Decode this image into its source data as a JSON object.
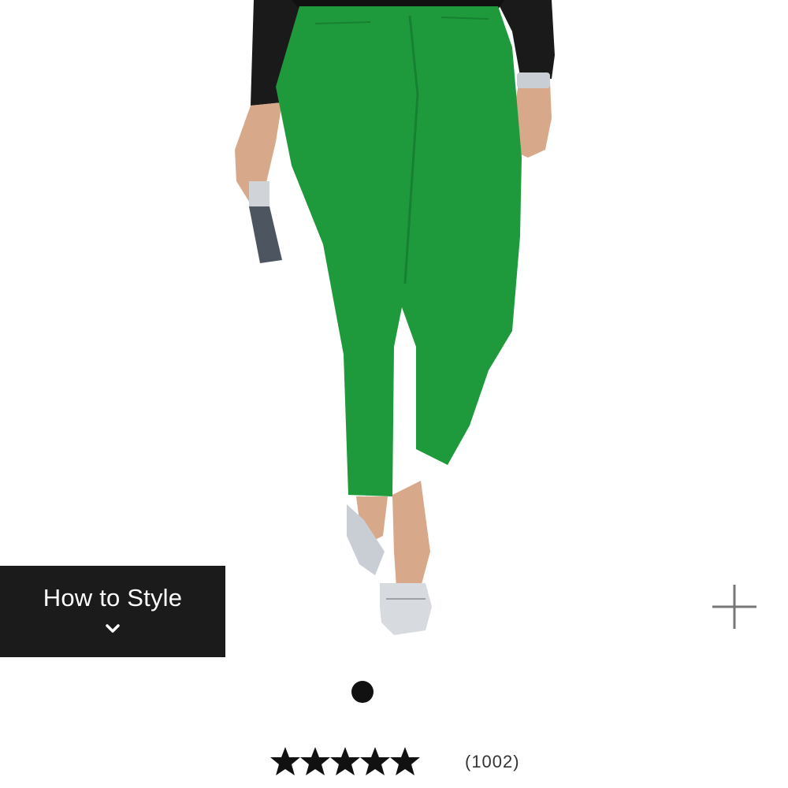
{
  "product": {
    "image_description_icon": "product-photo-green-pants",
    "colors": {
      "pants": "#1e9a3c",
      "top": "#1a1a1a",
      "skin": "#d8a88a",
      "shoes": "#c9ced4"
    }
  },
  "style_button": {
    "label": "How to Style",
    "icon": "chevron-down-icon",
    "background": "#1b1b1b"
  },
  "zoom": {
    "icon": "plus-icon"
  },
  "carousel": {
    "active_index": 1,
    "total": 1
  },
  "rating": {
    "value": 4.5,
    "max": 5,
    "review_count": "(1002)"
  }
}
